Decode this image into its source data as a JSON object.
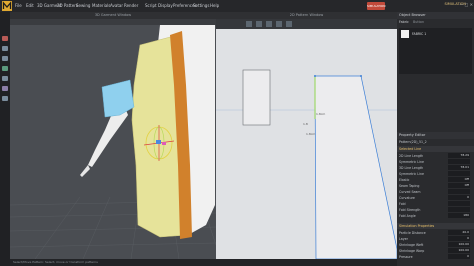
{
  "menubar": {
    "items": [
      "File",
      "Edit",
      "3D Garment",
      "2D Pattern",
      "Sewing",
      "Materials",
      "Avatar",
      "Render",
      "Script",
      "Display",
      "Preferences",
      "Settings",
      "Help"
    ],
    "layout_label": "SIMULATION",
    "user_label": "SIMULATION",
    "window_controls": "— □ ✕"
  },
  "window3d": {
    "title": "3D Garment Window"
  },
  "window2d": {
    "title": "2D Pattern Window",
    "labels": {
      "a": "1.8cm",
      "b": "1.8cm",
      "c": "1.8"
    }
  },
  "object_browser": {
    "title": "Object Browser",
    "tabs": [
      "Fabric",
      "Button"
    ],
    "item": "FABRIC 1"
  },
  "property_editor": {
    "title": "Property Editor",
    "selected_name": "Pattern(2D)_51_2",
    "sections": [
      {
        "header": "Selected Line",
        "rows": [
          {
            "label": "2D Line Length",
            "value": "78.29"
          },
          {
            "label": "Symmetric Line",
            "value": ""
          },
          {
            "label": "3D Line Length",
            "value": "78.01"
          },
          {
            "label": "Symmetric Line",
            "value": ""
          },
          {
            "label": "Elastic",
            "value": "Off"
          },
          {
            "label": "Seam Taping",
            "value": "Off"
          },
          {
            "label": "Curved Seam",
            "value": ""
          },
          {
            "label": "Curvature",
            "value": "0"
          },
          {
            "label": "Fold",
            "value": ""
          },
          {
            "label": "Fold Strength",
            "value": ""
          },
          {
            "label": "Fold Angle",
            "value": "180"
          }
        ]
      },
      {
        "header": "Simulation Properties",
        "rows": [
          {
            "label": "Particle Distance",
            "value": "20.0"
          },
          {
            "label": "Layer",
            "value": "0"
          },
          {
            "label": "Shrinkage Weft",
            "value": "100.00"
          },
          {
            "label": "Shrinkage Warp",
            "value": "100.00"
          },
          {
            "label": "Pressure",
            "value": "0"
          }
        ]
      }
    ]
  },
  "status_bar": {
    "text": "Select/Move Pattern: Select, move or transform patterns"
  },
  "colors": {
    "accent": "#c24a3a",
    "fabric_yellow": "#e6e39a",
    "trim_orange": "#d1812c",
    "sleeve_blue": "#8fd0ee",
    "pattern_blue": "#3d7fd6",
    "pattern_green": "#9fd86a"
  }
}
